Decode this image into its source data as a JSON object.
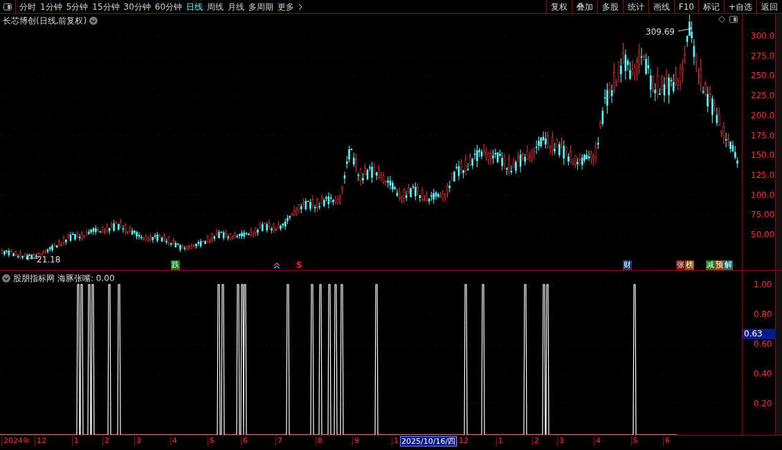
{
  "toolbar": {
    "periods": [
      {
        "label": "分时",
        "selected": false
      },
      {
        "label": "1分钟",
        "selected": false
      },
      {
        "label": "5分钟",
        "selected": false
      },
      {
        "label": "15分钟",
        "selected": false
      },
      {
        "label": "30分钟",
        "selected": false
      },
      {
        "label": "60分钟",
        "selected": false
      },
      {
        "label": "日线",
        "selected": true
      },
      {
        "label": "周线",
        "selected": false
      },
      {
        "label": "月线",
        "selected": false
      },
      {
        "label": "多周期",
        "selected": false
      },
      {
        "label": "更多",
        "selected": false
      }
    ],
    "buttons": [
      "复权",
      "叠加",
      "多股",
      "统计",
      "画线",
      "F10",
      "标记",
      "+自选",
      "返回"
    ]
  },
  "price_chart": {
    "title": "长芯博创(日线,前复权)",
    "high_label": "309.69",
    "low_label": "21.18",
    "axis_ticks": [
      "300.0",
      "275.0",
      "250.0",
      "225.0",
      "200.0",
      "175.0",
      "150.0",
      "125.0",
      "100.0",
      "75.00",
      "50.00"
    ],
    "markers": [
      {
        "kind": "tag",
        "segments": [
          {
            "text": "跌",
            "color": "#117a11"
          }
        ]
      },
      {
        "kind": "arrow"
      },
      {
        "kind": "letter",
        "segments": [
          {
            "text": "S",
            "color": "#ff2020"
          }
        ]
      },
      {
        "kind": "tag",
        "segments": [
          {
            "text": "财",
            "color": "#123a78"
          }
        ]
      },
      {
        "kind": "tag",
        "segments": [
          {
            "text": "张",
            "color": "#7a1010"
          },
          {
            "text": "榜",
            "color": "#8a4a14"
          }
        ]
      },
      {
        "kind": "tag",
        "segments": [
          {
            "text": "减",
            "color": "#117a11"
          },
          {
            "text": "预",
            "color": "#8a4a14"
          },
          {
            "text": "解",
            "color": "#0f6f7a"
          }
        ]
      }
    ]
  },
  "indicator": {
    "source": "股朋指标网",
    "reading": "海豚张嘴: 0.00",
    "axis_ticks": [
      "1.00",
      "0.80",
      "0.60",
      "0.40",
      "0.20"
    ],
    "cursor_value": "0.63"
  },
  "time_axis": [
    {
      "label": "2024年",
      "kind": "tick"
    },
    {
      "label": "12",
      "kind": "tick"
    },
    {
      "label": "1",
      "kind": "tick"
    },
    {
      "label": "2",
      "kind": "tick"
    },
    {
      "label": "3",
      "kind": "tick"
    },
    {
      "label": "4",
      "kind": "tick"
    },
    {
      "label": "5",
      "kind": "tick"
    },
    {
      "label": "6",
      "kind": "tick"
    },
    {
      "label": "7",
      "kind": "tick"
    },
    {
      "label": "8",
      "kind": "tick"
    },
    {
      "label": "9",
      "kind": "tick"
    },
    {
      "label": "1",
      "kind": "tick"
    },
    {
      "label": "2025/10/16/四",
      "kind": "cursor"
    },
    {
      "label": "12",
      "kind": "tick"
    },
    {
      "label": "1",
      "kind": "tick"
    },
    {
      "label": "2",
      "kind": "tick"
    },
    {
      "label": "3",
      "kind": "tick"
    },
    {
      "label": "4",
      "kind": "tick"
    },
    {
      "label": "5",
      "kind": "tick"
    },
    {
      "label": "6",
      "kind": "tick"
    }
  ]
}
